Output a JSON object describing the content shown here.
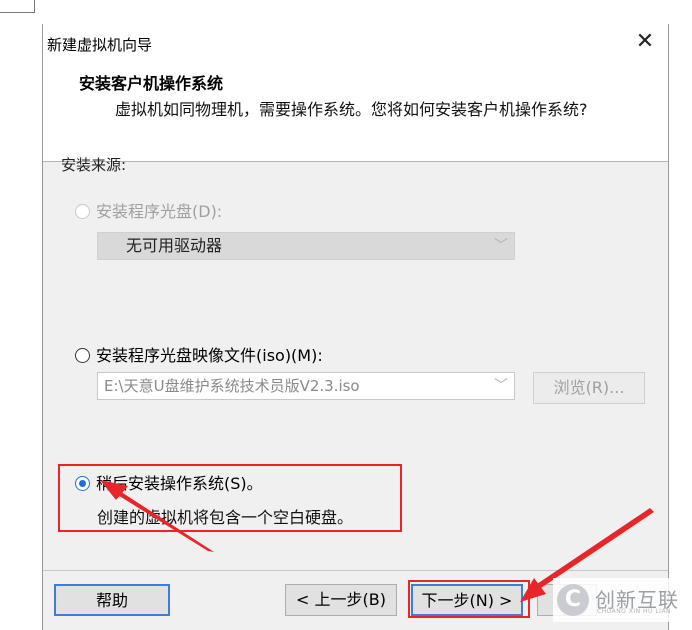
{
  "window": {
    "title": "新建虚拟机向导",
    "close_glyph": "✕"
  },
  "header": {
    "title": "安装客户机操作系统",
    "subtitle": "虚拟机如同物理机，需要操作系统。您将如何安装客户机操作系统?"
  },
  "install_source": {
    "label": "安装来源:",
    "options": [
      {
        "label": "安装程序光盘(D):",
        "selected": false,
        "enabled": false
      },
      {
        "label": "安装程序光盘映像文件(iso)(M):",
        "selected": false,
        "enabled": true
      },
      {
        "label": "稍后安装操作系统(S)。",
        "selected": true,
        "enabled": true
      }
    ],
    "drive_select": {
      "value": "无可用驱动器",
      "enabled": false
    },
    "iso_path": {
      "value": "E:\\天意U盘维护系统技术员版V2.3.iso",
      "enabled": false
    },
    "browse_button": "浏览(R)...",
    "later_description": "创建的虚拟机将包含一个空白硬盘。"
  },
  "footer": {
    "help_button": "帮助",
    "back_button": "< 上一步(B)",
    "next_button": "下一步(N) >"
  },
  "annotations": {
    "highlight_color": "#e8262a"
  },
  "watermark": {
    "logo_glyph": "C",
    "text": "创新互联",
    "subtext": "CHUANG XIN HU LIAN"
  },
  "colors": {
    "accent": "#1a6fd6",
    "dialog_bg": "#f0f0f0",
    "disabled_text": "#a0a0a0"
  }
}
